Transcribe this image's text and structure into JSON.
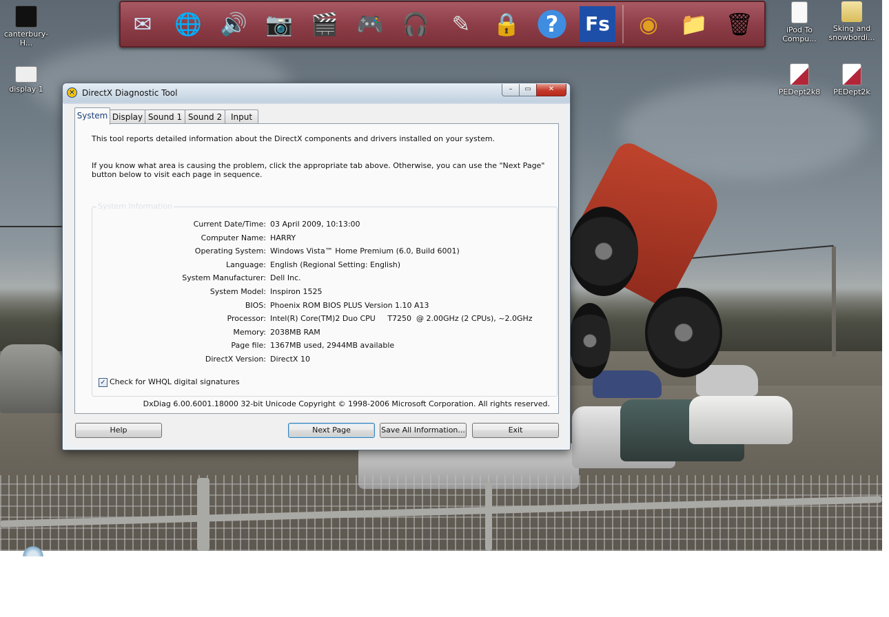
{
  "desktop": {
    "icons_left": [
      {
        "label": "canterbury-H..."
      },
      {
        "label": "display 1"
      }
    ],
    "icons_right": [
      {
        "label": "iPod To Compu..."
      },
      {
        "label": "Sking and snowbordi..."
      },
      {
        "label": "PEDept2k8"
      },
      {
        "label": "PEDept2k"
      }
    ]
  },
  "dock": {
    "items": [
      {
        "icon": "mail-icon",
        "glyph": "✉"
      },
      {
        "icon": "globe-icon",
        "glyph": "🌐"
      },
      {
        "icon": "speaker-icon",
        "glyph": "🔊"
      },
      {
        "icon": "camera-icon",
        "glyph": "📷"
      },
      {
        "icon": "clapperboard-icon",
        "glyph": "🎬"
      },
      {
        "icon": "gamepad-icon",
        "glyph": "🎮"
      },
      {
        "icon": "headphones-icon",
        "glyph": "🎧"
      },
      {
        "icon": "pencil-cup-icon",
        "glyph": "✎"
      },
      {
        "icon": "security-shield-icon",
        "glyph": "🔒"
      },
      {
        "icon": "help-icon",
        "glyph": "?"
      },
      {
        "icon": "fs-app-icon",
        "glyph": "Fs"
      },
      {
        "icon": "windows-logo-icon",
        "glyph": "◉"
      },
      {
        "icon": "folder-icon",
        "glyph": "📁"
      },
      {
        "icon": "recycle-bin-icon",
        "glyph": "🗑"
      }
    ]
  },
  "window": {
    "title": "DirectX Diagnostic Tool",
    "controls": {
      "minimize": "–",
      "maximize": "▭",
      "close": "✕"
    },
    "tabs": [
      "System",
      "Display",
      "Sound 1",
      "Sound 2",
      "Input"
    ],
    "active_tab": "System",
    "intro_1": "This tool reports detailed information about the DirectX components and drivers installed on your system.",
    "intro_2": "If you know what area is causing the problem, click the appropriate tab above.  Otherwise, you can use the \"Next Page\" button below to visit each page in sequence.",
    "group_title": "System Information",
    "system_info": [
      {
        "label": "Current Date/Time:",
        "value": "03 April 2009, 10:13:00"
      },
      {
        "label": "Computer Name:",
        "value": "HARRY"
      },
      {
        "label": "Operating System:",
        "value": "Windows Vista™ Home Premium (6.0, Build 6001)"
      },
      {
        "label": "Language:",
        "value": "English (Regional Setting: English)"
      },
      {
        "label": "System Manufacturer:",
        "value": "Dell Inc."
      },
      {
        "label": "System Model:",
        "value": "Inspiron 1525"
      },
      {
        "label": "BIOS:",
        "value": "Phoenix ROM BIOS PLUS Version 1.10 A13"
      },
      {
        "label": "Processor:",
        "value": "Intel(R) Core(TM)2 Duo CPU     T7250  @ 2.00GHz (2 CPUs), ~2.0GHz"
      },
      {
        "label": "Memory:",
        "value": "2038MB RAM"
      },
      {
        "label": "Page file:",
        "value": "1367MB used, 2944MB available"
      },
      {
        "label": "DirectX Version:",
        "value": "DirectX 10"
      }
    ],
    "whql_checkbox": {
      "label": "Check for WHQL digital signatures",
      "checked": true,
      "mark": "✓"
    },
    "footer": "DxDiag 6.00.6001.18000 32-bit Unicode  Copyright © 1998-2006 Microsoft Corporation.  All rights reserved.",
    "buttons": {
      "help": "Help",
      "next_page": "Next Page",
      "save_all": "Save All Information...",
      "exit": "Exit"
    }
  }
}
